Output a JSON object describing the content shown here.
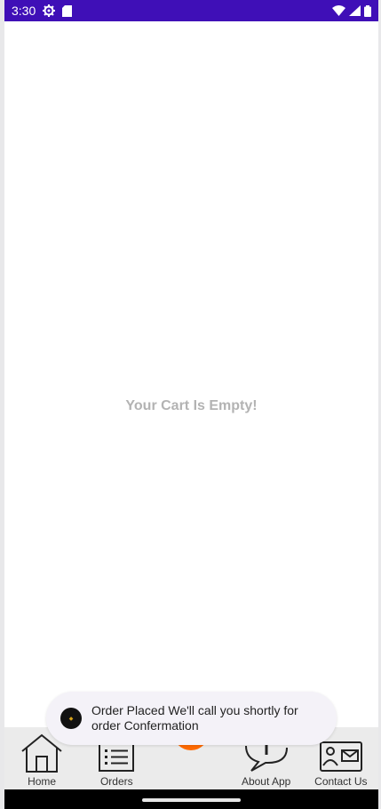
{
  "status_bar": {
    "time": "3:30",
    "icons": [
      "settings-gear-icon",
      "sd-card-icon",
      "wifi-icon",
      "signal-icon",
      "battery-icon"
    ],
    "background": "#3f0fb7"
  },
  "cart": {
    "empty_message": "Your Cart Is Empty!"
  },
  "toast": {
    "message": "Order Placed We'll call you shortly for order Confermation"
  },
  "bottom_nav": {
    "items": [
      {
        "label": "Home",
        "icon": "home-icon"
      },
      {
        "label": "Orders",
        "icon": "orders-list-icon"
      },
      {
        "label": "About App",
        "icon": "info-bubble-icon"
      },
      {
        "label": "Contact Us",
        "icon": "contact-card-icon"
      }
    ],
    "fab_color": "#ff6a00"
  }
}
